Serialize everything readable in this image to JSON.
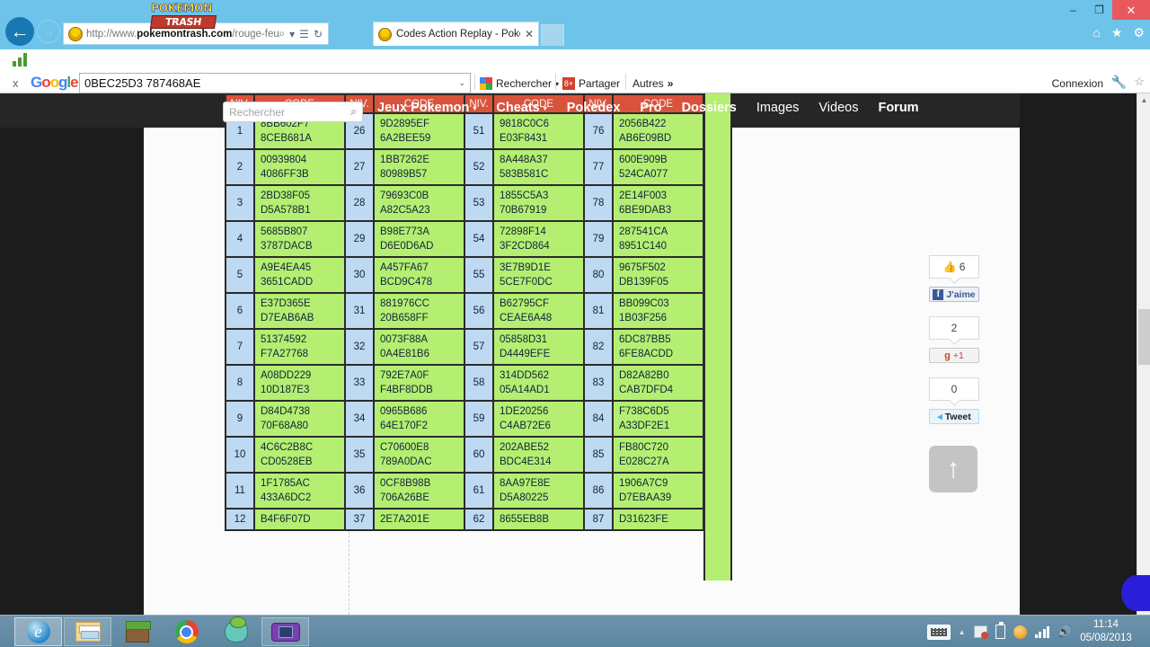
{
  "browser": {
    "window_controls": {
      "minimize": "–",
      "maximize": "❐",
      "close": "✕"
    },
    "back_icon": "←",
    "forward_icon": "→",
    "address": {
      "scheme": "http://www.",
      "domain": "pokemontrash.com",
      "path": "/rouge-feu-vert-fe",
      "search_icon": "⌕",
      "dropdown_icon": "▾",
      "compat_icon": "☰",
      "refresh_icon": "↻"
    },
    "tab": {
      "title": "Codes Action Replay - Poke...",
      "close": "✕"
    },
    "right_icons": [
      {
        "name": "home-icon",
        "glyph": "⌂"
      },
      {
        "name": "favorites-icon",
        "glyph": "★"
      },
      {
        "name": "tools-icon",
        "glyph": "⚙"
      }
    ]
  },
  "google_toolbar": {
    "close_label": "x",
    "logo_letters": [
      "G",
      "o",
      "o",
      "g",
      "l",
      "e"
    ],
    "search_value": "0BEC25D3 787468AE",
    "search_dropdown": "⌄",
    "rechercher_label": "Rechercher",
    "rechercher_caret": "▾",
    "partager_label": "Partager",
    "partager_icon": "8+",
    "autres_label": "Autres",
    "autres_icon": "»",
    "connexion_label": "Connexion",
    "wrench_icon": "🔧",
    "star_icon": "☆"
  },
  "site": {
    "logo_top": "POKEMON",
    "logo_bottom": "TRASH",
    "search_placeholder": "Rechercher",
    "search_icon": "⌕",
    "nav": [
      {
        "label": "Jeux Pokemon",
        "caret": "▾",
        "bold": true
      },
      {
        "label": "Cheats",
        "caret": "▾",
        "bold": true
      },
      {
        "label": "Pokedex",
        "caret": "",
        "bold": true
      },
      {
        "label": "Pro",
        "caret": "",
        "bold": true
      },
      {
        "label": "Dossiers",
        "caret": "",
        "bold": true
      },
      {
        "label": "Images",
        "caret": "",
        "bold": false
      },
      {
        "label": "Videos",
        "caret": "",
        "bold": false
      },
      {
        "label": "Forum",
        "caret": "",
        "bold": true
      }
    ]
  },
  "table": {
    "headers": [
      "NIV.",
      "CODE",
      "NIV.",
      "CODE",
      "NIV.",
      "CODE",
      "NIV.",
      "CODE"
    ],
    "rows": [
      [
        "1",
        "8BB602F7\n8CEB681A",
        "26",
        "9D2895EF\n6A2BEE59",
        "51",
        "9818C0C6\nE03F8431",
        "76",
        "2056B422\nAB6E09BD"
      ],
      [
        "2",
        "00939804\n4086FF3B",
        "27",
        "1BB7262E\n80989B57",
        "52",
        "8A448A37\n583B581C",
        "77",
        "600E909B\n524CA077"
      ],
      [
        "3",
        "2BD38F05\nD5A578B1",
        "28",
        "79693C0B\nA82C5A23",
        "53",
        "1855C5A3\n70B67919",
        "78",
        "2E14F003\n6BE9DAB3"
      ],
      [
        "4",
        "5685B807\n3787DACB",
        "29",
        "B98E773A\nD6E0D6AD",
        "54",
        "72898F14\n3F2CD864",
        "79",
        "287541CA\n8951C140"
      ],
      [
        "5",
        "A9E4EA45\n3651CADD",
        "30",
        "A457FA67\nBCD9C478",
        "55",
        "3E7B9D1E\n5CE7F0DC",
        "80",
        "9675F502\nDB139F05"
      ],
      [
        "6",
        "E37D365E\nD7EAB6AB",
        "31",
        "881976CC\n20B658FF",
        "56",
        "B62795CF\nCEAE6A48",
        "81",
        "BB099C03\n1B03F256"
      ],
      [
        "7",
        "51374592\nF7A27768",
        "32",
        "0073F88A\n0A4E81B6",
        "57",
        "05858D31\nD4449EFE",
        "82",
        "6DC87BB5\n6FE8ACDD"
      ],
      [
        "8",
        "A08DD229\n10D187E3",
        "33",
        "792E7A0F\nF4BF8DDB",
        "58",
        "314DD562\n05A14AD1",
        "83",
        "D82A82B0\nCAB7DFD4"
      ],
      [
        "9",
        "D84D4738\n70F68A80",
        "34",
        "0965B686\n64E170F2",
        "59",
        "1DE20256\nC4AB72E6",
        "84",
        "F738C6D5\nA33DF2E1"
      ],
      [
        "10",
        "4C6C2B8C\nCD0528EB",
        "35",
        "C70600E8\n789A0DAC",
        "60",
        "202ABE52\nBDC4E314",
        "85",
        "FB80C720\nE028C27A"
      ],
      [
        "11",
        "1F1785AC\n433A6DC2",
        "36",
        "0CF8B98B\n706A26BE",
        "61",
        "8AA97E8E\nD5A80225",
        "86",
        "1906A7C9\nD7EBAA39"
      ],
      [
        "12",
        "B4F6F07D",
        "37",
        "2E7A201E",
        "62",
        "8655EB8B",
        "87",
        "D31623FE"
      ]
    ]
  },
  "social": {
    "facebook_count": "6",
    "facebook_label": "J'aime",
    "facebook_thumb": "👍",
    "facebook_icon": "f",
    "google_count": "2",
    "google_label": "+1",
    "google_icon": "g",
    "twitter_count": "0",
    "twitter_label": "Tweet",
    "twitter_icon": "◂"
  },
  "scroll_top": {
    "icon": "↑"
  },
  "scrollbar": {
    "up": "▲",
    "down": "▼"
  },
  "taskbar": {
    "items": [
      {
        "name": "internet-explorer",
        "state": "active"
      },
      {
        "name": "file-explorer",
        "state": "open"
      },
      {
        "name": "minecraft",
        "state": "plain"
      },
      {
        "name": "google-chrome",
        "state": "plain"
      },
      {
        "name": "pokemon-app",
        "state": "plain"
      },
      {
        "name": "gba-emulator",
        "state": "open"
      }
    ],
    "tray": {
      "show_hidden": "▲",
      "action_center": "flag",
      "battery": "battery",
      "antivirus": "circle",
      "network": "bars",
      "volume": "🔊"
    },
    "clock_time": "11:14",
    "clock_date": "05/08/2013"
  }
}
